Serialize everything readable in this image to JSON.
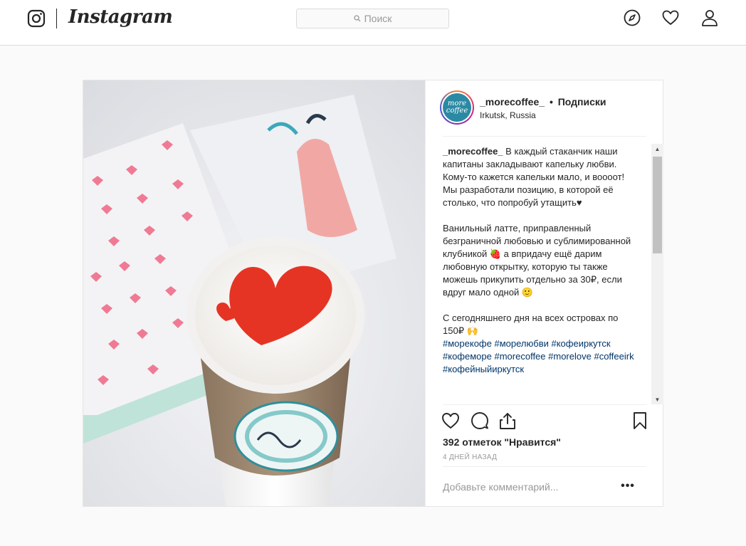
{
  "nav": {
    "brand": "Instagram",
    "search_placeholder": "Поиск",
    "icons": [
      "instagram-glyph-icon",
      "search-icon",
      "compass-icon",
      "heart-icon",
      "profile-icon"
    ]
  },
  "post": {
    "username": "_morecoffee_",
    "separator": "•",
    "follow_label": "Подписки",
    "location": "Irkutsk, Russia",
    "avatar_text": "more coffee",
    "caption": {
      "lines_1": "В каждый стаканчик наши капитаны закладывают капельку любви. Кому-то кажется капельки мало, и воооот! Мы разработали позицию, в которой её столько, что попробуй утащить♥",
      "lines_2": "Ванильный латте, приправленный безграничной любовью и сублимированной клубникой 🍓 а впридачу ещё дарим любовную открытку, которую ты также можешь прикупить отдельно за 30₽, если вдруг мало одной 🙂",
      "lines_3": "С сегодняшнего дня на всех островах по 150₽ 🙌",
      "hashtags": [
        "#морекофе",
        "#морелюбви",
        "#кофеиркутск",
        "#кофеморе",
        "#morecoffee",
        "#morelove",
        "#coffeeirk",
        "#кофейныйиркутск"
      ]
    },
    "likes_text": "392 отметок \"Нравится\"",
    "time_text": "4 дней назад",
    "comment_placeholder": "Добавьте комментарий...",
    "more_label": "•••"
  },
  "colors": {
    "accent_link": "#003569",
    "border": "#dbdbdb",
    "background": "#fafafa"
  }
}
